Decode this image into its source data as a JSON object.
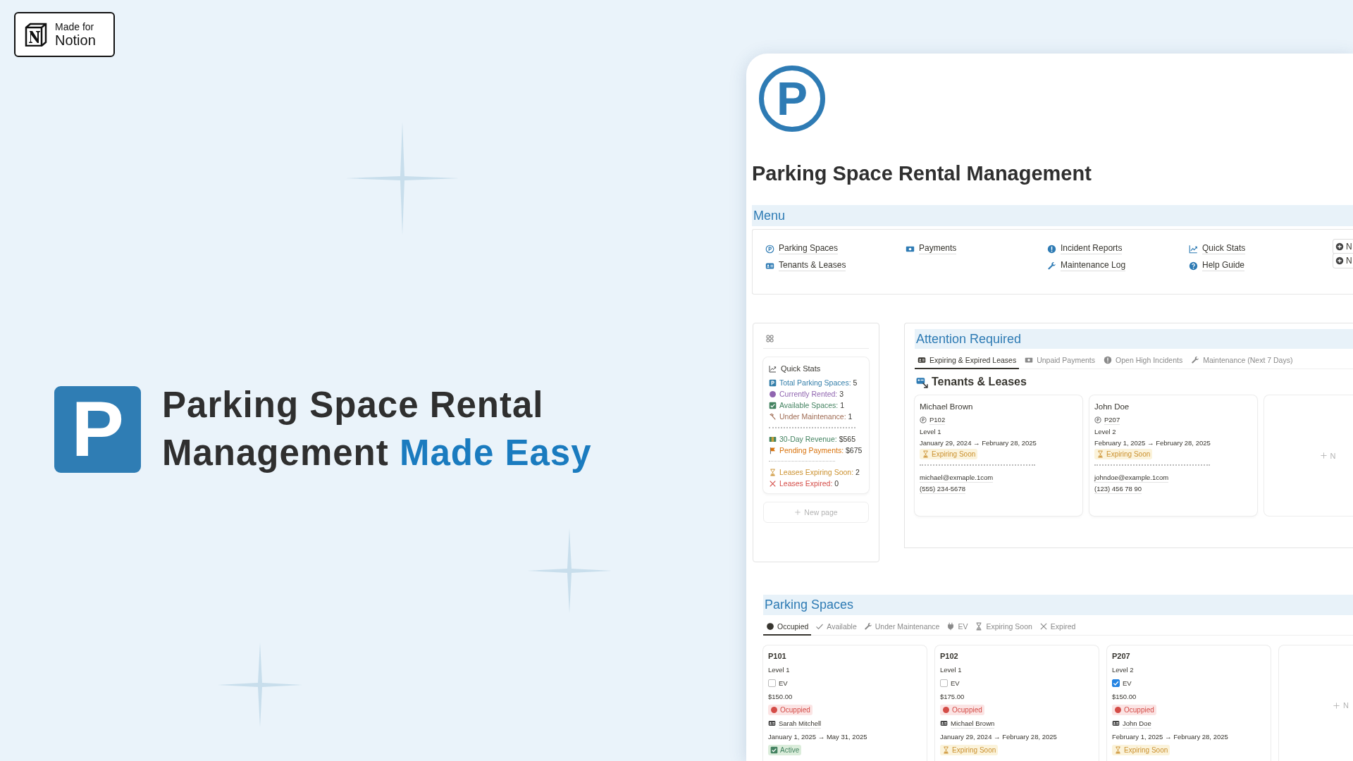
{
  "badge": {
    "line_1": "Made for",
    "line_2": "Notion"
  },
  "hero": {
    "logo_letter": "P",
    "headline": "Parking Space Rental Management",
    "highlight": "Made Easy"
  },
  "page": {
    "icon_letter": "P",
    "title": "Parking Space Rental Management"
  },
  "menu": {
    "heading": "Menu",
    "columns": [
      [
        {
          "label": "Parking Spaces",
          "kind": "parking"
        },
        {
          "label": "Tenants & Leases",
          "kind": "idcard"
        }
      ],
      [
        {
          "label": "Payments",
          "kind": "cash"
        }
      ],
      [
        {
          "label": "Incident Reports",
          "kind": "alert"
        },
        {
          "label": "Maintenance Log",
          "kind": "wrench"
        }
      ],
      [
        {
          "label": "Quick Stats",
          "kind": "chart"
        },
        {
          "label": "Help Guide",
          "kind": "help"
        }
      ]
    ],
    "buttons": [
      "N",
      "N"
    ]
  },
  "quick_stats": {
    "title": "Quick Stats",
    "groups": [
      [
        {
          "label": "Total Parking Spaces:",
          "value": "5",
          "color": "#337ea9",
          "kind": "psquare"
        },
        {
          "label": "Currently Rented:",
          "value": "3",
          "color": "#9065b0",
          "kind": "dot"
        },
        {
          "label": "Available Spaces:",
          "value": "1",
          "color": "#448361",
          "kind": "checkbox"
        },
        {
          "label": "Under Maintenance:",
          "value": "1",
          "color": "#9f6b53",
          "kind": "hammer"
        }
      ],
      [
        {
          "label": "30-Day Revenue:",
          "value": "$565",
          "color": "#448361",
          "kind": "money"
        },
        {
          "label": "Pending Payments:",
          "value": "$675",
          "color": "#d9730d",
          "kind": "flag"
        }
      ],
      [
        {
          "label": "Leases Expiring Soon:",
          "value": "2",
          "color": "#cb912f",
          "kind": "hourglass"
        },
        {
          "label": "Leases Expired:",
          "value": "0",
          "color": "#d44c47",
          "kind": "cross"
        }
      ]
    ],
    "new_page": "New page"
  },
  "attention": {
    "heading": "Attention Required",
    "tabs": [
      {
        "label": "Expiring & Expired Leases",
        "kind": "idcard",
        "selected": true
      },
      {
        "label": "Unpaid Payments",
        "kind": "cash",
        "selected": false
      },
      {
        "label": "Open High Incidents",
        "kind": "alert",
        "selected": false
      },
      {
        "label": "Maintenance (Next 7 Days)",
        "kind": "wrench",
        "selected": false
      }
    ],
    "view_title": "Tenants & Leases",
    "cards": [
      {
        "name": "Michael Brown",
        "space": "P102",
        "level": "Level 1",
        "dates": "January 29, 2024 → February 28, 2025",
        "status": {
          "text": "Expiring Soon",
          "kind": "expiring"
        },
        "email": "michael@exmaple.1com",
        "phone": "(555) 234-5678"
      },
      {
        "name": "John Doe",
        "space": "P207",
        "level": "Level 2",
        "dates": "February 1, 2025 → February 28, 2025",
        "status": {
          "text": "Expiring Soon",
          "kind": "expiring"
        },
        "email": "johndoe@example.1com",
        "phone": "(123) 456 78 90"
      }
    ],
    "add_label": "N"
  },
  "parking": {
    "heading": "Parking Spaces",
    "tabs": [
      {
        "label": "Occupied",
        "kind": "dot",
        "selected": true
      },
      {
        "label": "Available",
        "kind": "check",
        "selected": false
      },
      {
        "label": "Under Maintenance",
        "kind": "wrench",
        "selected": false
      },
      {
        "label": "EV",
        "kind": "plug",
        "selected": false
      },
      {
        "label": "Expiring Soon",
        "kind": "hourglass",
        "selected": false
      },
      {
        "label": "Expired",
        "kind": "cross",
        "selected": false
      }
    ],
    "cards": [
      {
        "space": "P101",
        "level": "Level 1",
        "ev_label": "EV",
        "ev": false,
        "rate": "$150.00",
        "status": {
          "text": "Ocuppied",
          "kind": "occupied"
        },
        "tenant": "Sarah Mitchell",
        "dates": "January 1, 2025 → May 31, 2025",
        "lease": {
          "text": "Active",
          "kind": "active"
        }
      },
      {
        "space": "P102",
        "level": "Level 1",
        "ev_label": "EV",
        "ev": false,
        "rate": "$175.00",
        "status": {
          "text": "Ocuppied",
          "kind": "occupied"
        },
        "tenant": "Michael Brown",
        "dates": "January 29, 2024 → February 28, 2025",
        "lease": {
          "text": "Expiring Soon",
          "kind": "expiring"
        }
      },
      {
        "space": "P207",
        "level": "Level 2",
        "ev_label": "EV",
        "ev": true,
        "rate": "$150.00",
        "status": {
          "text": "Ocuppied",
          "kind": "occupied"
        },
        "tenant": "John Doe",
        "dates": "February 1, 2025 → February 28, 2025",
        "lease": {
          "text": "Expiring Soon",
          "kind": "expiring"
        }
      }
    ],
    "add_label": "N"
  }
}
